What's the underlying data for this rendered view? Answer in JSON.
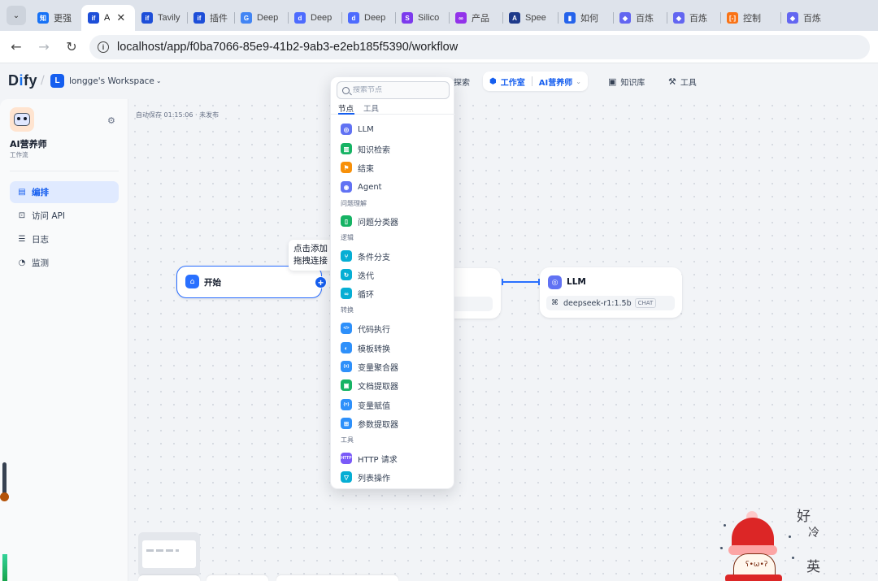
{
  "browser": {
    "tabs": [
      {
        "title": "更强",
        "favicon": "知",
        "color": "#1772f6",
        "active": false
      },
      {
        "title": "A",
        "favicon": "if",
        "color": "#1d4ed8",
        "active": true
      },
      {
        "title": "Tavily",
        "favicon": "if",
        "color": "#1d4ed8",
        "active": false
      },
      {
        "title": "插件",
        "favicon": "if",
        "color": "#1d4ed8",
        "active": false
      },
      {
        "title": "Deep",
        "favicon": "G",
        "color": "#4285f4",
        "active": false
      },
      {
        "title": "Deep",
        "favicon": "d",
        "color": "#4d6bfe",
        "active": false
      },
      {
        "title": "Deep",
        "favicon": "d",
        "color": "#4d6bfe",
        "active": false
      },
      {
        "title": "Silico",
        "favicon": "S",
        "color": "#7c3aed",
        "active": false
      },
      {
        "title": "产品",
        "favicon": "∞",
        "color": "#9333ea",
        "active": false
      },
      {
        "title": "Spee",
        "favicon": "A",
        "color": "#1e3a8a",
        "active": false
      },
      {
        "title": "如何",
        "favicon": "▮",
        "color": "#2563eb",
        "active": false
      },
      {
        "title": "百炼",
        "favicon": "◆",
        "color": "#6366f1",
        "active": false
      },
      {
        "title": "百炼",
        "favicon": "◆",
        "color": "#6366f1",
        "active": false
      },
      {
        "title": "控制",
        "favicon": "[-]",
        "color": "#f97316",
        "active": false
      },
      {
        "title": "百炼",
        "favicon": "◆",
        "color": "#6366f1",
        "active": false
      }
    ],
    "close_glyph": "✕",
    "menu_glyph": "⌄",
    "url": "localhost/app/f0ba7066-85e9-41b2-9ab3-e2eb185f5390/workflow"
  },
  "header": {
    "logo_d": "D",
    "logo_i": "i",
    "logo_rest": "fy",
    "workspace_badge": "L",
    "workspace_name": "longge's Workspace",
    "explore": "探索",
    "studio": "工作室",
    "current_app": "AI营养师",
    "knowledge": "知识库",
    "tools": "工具"
  },
  "sidebar": {
    "app_name": "AI营养师",
    "app_type": "工作流",
    "nav": [
      {
        "label": "编排",
        "icon": "layout-icon",
        "glyph": "▤",
        "active": true
      },
      {
        "label": "访问 API",
        "icon": "terminal-icon",
        "glyph": "⊡",
        "active": false
      },
      {
        "label": "日志",
        "icon": "log-icon",
        "glyph": "☰",
        "active": false
      },
      {
        "label": "监测",
        "icon": "monitor-icon",
        "glyph": "◔",
        "active": false
      }
    ]
  },
  "canvas": {
    "autosave": "自动保存 01:15:06 · 未发布",
    "start_node": "开始",
    "tooltip_line1": "点击添加",
    "tooltip_line2": "拖拽连接",
    "hidden_node_value": ".",
    "llm_node": "LLM",
    "llm_model": "deepseek-r1:1.5b",
    "llm_mode": "CHAT"
  },
  "picker": {
    "search_placeholder": "搜索节点",
    "tab_nodes": "节点",
    "tab_tools": "工具",
    "entries": [
      {
        "kind": "item",
        "label": "LLM",
        "color": "#6172f3",
        "glyph": "◎"
      },
      {
        "kind": "item",
        "label": "知识检索",
        "color": "#16b364",
        "glyph": "▥"
      },
      {
        "kind": "item",
        "label": "结束",
        "color": "#f79009",
        "glyph": "⚑"
      },
      {
        "kind": "item",
        "label": "Agent",
        "color": "#6172f3",
        "glyph": "◉"
      },
      {
        "kind": "group",
        "label": "问题理解"
      },
      {
        "kind": "item",
        "label": "问题分类器",
        "color": "#16b364",
        "glyph": "▯"
      },
      {
        "kind": "group",
        "label": "逻辑"
      },
      {
        "kind": "item",
        "label": "条件分支",
        "color": "#06aed4",
        "glyph": "⑂"
      },
      {
        "kind": "item",
        "label": "迭代",
        "color": "#06aed4",
        "glyph": "↻"
      },
      {
        "kind": "item",
        "label": "循环",
        "color": "#06aed4",
        "glyph": "∞"
      },
      {
        "kind": "group",
        "label": "转换"
      },
      {
        "kind": "item",
        "label": "代码执行",
        "color": "#2e90fa",
        "glyph": "</>"
      },
      {
        "kind": "item",
        "label": "模板转换",
        "color": "#2e90fa",
        "glyph": "◐"
      },
      {
        "kind": "item",
        "label": "变量聚合器",
        "color": "#2e90fa",
        "glyph": "{x}"
      },
      {
        "kind": "item",
        "label": "文档提取器",
        "color": "#16b364",
        "glyph": "▣"
      },
      {
        "kind": "item",
        "label": "变量赋值",
        "color": "#2e90fa",
        "glyph": "{=}"
      },
      {
        "kind": "item",
        "label": "参数提取器",
        "color": "#2e90fa",
        "glyph": "⊞"
      },
      {
        "kind": "group",
        "label": "工具"
      },
      {
        "kind": "item",
        "label": "HTTP 请求",
        "color": "#7a5af8",
        "glyph": "HTTP"
      },
      {
        "kind": "item",
        "label": "列表操作",
        "color": "#06aed4",
        "glyph": "▽"
      }
    ]
  },
  "sticker": {
    "text_top": "好",
    "text_mid": "冷",
    "text_bottom": "英",
    "face": "ʕ•ω•ʔ"
  }
}
